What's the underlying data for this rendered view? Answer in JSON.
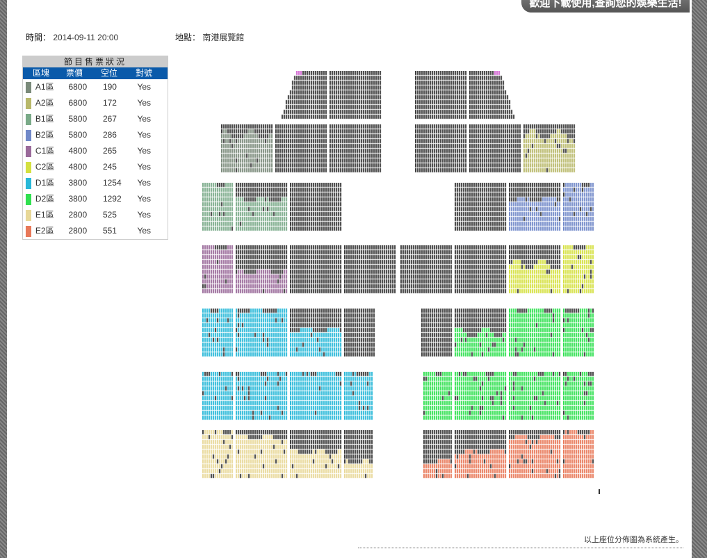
{
  "banner": {
    "text": "歡迎下載使用,查詢您的娛樂生活!"
  },
  "info": {
    "time_label": "時間：",
    "time_value": "2014-09-11 20:00",
    "place_label": "地點：",
    "place_value": "南港展覽館"
  },
  "legend": {
    "caption": "節目售票狀況",
    "headers": [
      "區塊",
      "票價",
      "空位",
      "對號"
    ],
    "rows": [
      {
        "zone": "A1區",
        "price": "6800",
        "empty": "190",
        "numbered": "Yes",
        "color": "#7a8a7a"
      },
      {
        "zone": "A2區",
        "price": "6800",
        "empty": "172",
        "numbered": "Yes",
        "color": "#b8b86a"
      },
      {
        "zone": "B1區",
        "price": "5800",
        "empty": "267",
        "numbered": "Yes",
        "color": "#7aaa88"
      },
      {
        "zone": "B2區",
        "price": "5800",
        "empty": "286",
        "numbered": "Yes",
        "color": "#7088c8"
      },
      {
        "zone": "C1區",
        "price": "4800",
        "empty": "265",
        "numbered": "Yes",
        "color": "#9a6a9a"
      },
      {
        "zone": "C2區",
        "price": "4800",
        "empty": "245",
        "numbered": "Yes",
        "color": "#d4e040"
      },
      {
        "zone": "D1區",
        "price": "3800",
        "empty": "1254",
        "numbered": "Yes",
        "color": "#28b8d8"
      },
      {
        "zone": "D2區",
        "price": "3800",
        "empty": "1292",
        "numbered": "Yes",
        "color": "#30e050"
      },
      {
        "zone": "E1區",
        "price": "2800",
        "empty": "525",
        "numbered": "Yes",
        "color": "#e8d898"
      },
      {
        "zone": "E2區",
        "price": "2800",
        "empty": "551",
        "numbered": "Yes",
        "color": "#e87858"
      }
    ]
  },
  "note": "以上座位分佈圖為系統產生。"
}
